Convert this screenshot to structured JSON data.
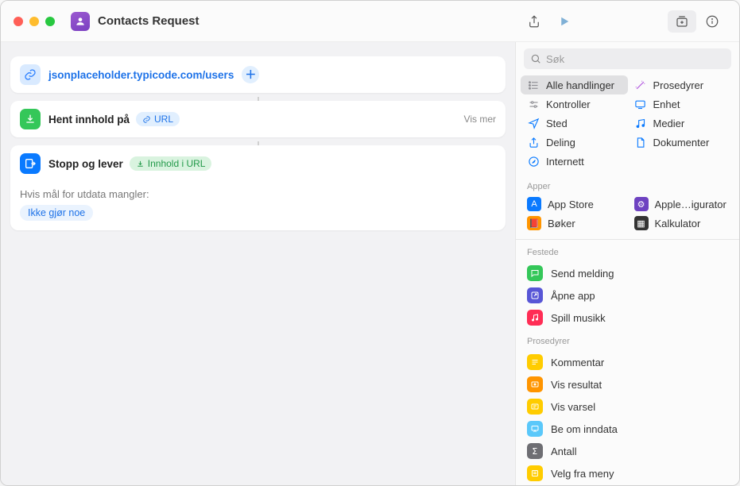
{
  "title": "Contacts Request",
  "toolbar": {
    "share_icon": "share",
    "play_icon": "play"
  },
  "actions": {
    "url": {
      "value": "jsonplaceholder.typicode.com/users"
    },
    "get_contents": {
      "title": "Hent innhold på",
      "token": "URL",
      "show_more": "Vis mer"
    },
    "stop": {
      "title": "Stopp og lever",
      "token": "Innhold i URL",
      "sub_label": "Hvis mål for utdata mangler:",
      "do_nothing": "Ikke gjør noe"
    }
  },
  "sidebar": {
    "search_placeholder": "Søk",
    "categories": [
      {
        "label": "Alle handlinger",
        "icon": "list",
        "color": "#8e8e93",
        "selected": true
      },
      {
        "label": "Prosedyrer",
        "icon": "wand",
        "color": "#af52de"
      },
      {
        "label": "Kontroller",
        "icon": "sliders",
        "color": "#8e8e93"
      },
      {
        "label": "Enhet",
        "icon": "device",
        "color": "#0a7aff"
      },
      {
        "label": "Sted",
        "icon": "location",
        "color": "#0a7aff"
      },
      {
        "label": "Medier",
        "icon": "music",
        "color": "#0a7aff"
      },
      {
        "label": "Deling",
        "icon": "share",
        "color": "#0a7aff"
      },
      {
        "label": "Dokumenter",
        "icon": "document",
        "color": "#0a7aff"
      },
      {
        "label": "Internett",
        "icon": "safari",
        "color": "#0a7aff"
      }
    ],
    "apps_header": "Apper",
    "apps": [
      {
        "label": "App Store",
        "bg": "#0a7aff",
        "glyph": "A"
      },
      {
        "label": "Apple…igurator",
        "bg": "#6e42c1",
        "glyph": "⚙"
      },
      {
        "label": "Bøker",
        "bg": "#ff9500",
        "glyph": "📕"
      },
      {
        "label": "Kalkulator",
        "bg": "#333333",
        "glyph": "▦"
      }
    ],
    "pinned_header": "Festede",
    "pinned": [
      {
        "label": "Send melding",
        "bg": "#34c759",
        "icon": "message"
      },
      {
        "label": "Åpne app",
        "bg": "#5856d6",
        "icon": "openapp"
      },
      {
        "label": "Spill musikk",
        "bg": "#ff2d55",
        "icon": "music"
      }
    ],
    "procedures_header": "Prosedyrer",
    "procedures": [
      {
        "label": "Kommentar",
        "bg": "#ffcc00",
        "icon": "comment"
      },
      {
        "label": "Vis resultat",
        "bg": "#ff9500",
        "icon": "result"
      },
      {
        "label": "Vis varsel",
        "bg": "#ffcc00",
        "icon": "alert"
      },
      {
        "label": "Be om inndata",
        "bg": "#5ac8fa",
        "icon": "input"
      },
      {
        "label": "Antall",
        "bg": "#6e6e73",
        "icon": "sigma"
      },
      {
        "label": "Velg fra meny",
        "bg": "#ffcc00",
        "icon": "menu"
      }
    ]
  }
}
